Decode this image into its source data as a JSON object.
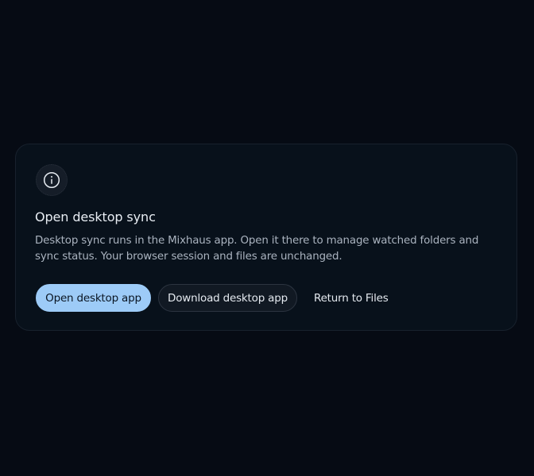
{
  "dialog": {
    "icon": "info-icon",
    "title": "Open desktop sync",
    "description": "Desktop sync runs in the Mixhaus app. Open it there to manage watched folders and sync status. Your browser session and files are unchanged.",
    "primary_action": "Open desktop app",
    "secondary_action": "Download desktop app",
    "tertiary_action": "Return to Files"
  },
  "colors": {
    "background": "#060b14",
    "card": "#08111b",
    "primary": "#9dcbf7"
  }
}
